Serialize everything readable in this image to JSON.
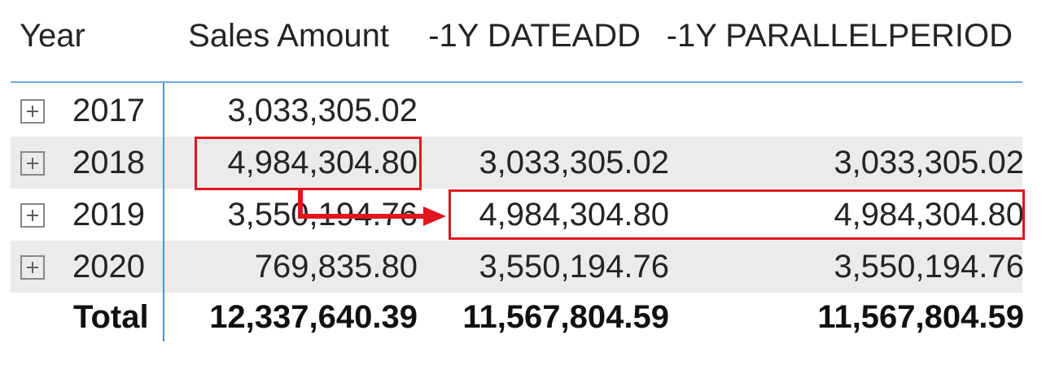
{
  "headers": {
    "year": "Year",
    "sales_amount": "Sales Amount",
    "dateadd": "-1Y DATEADD",
    "parallelperiod": "-1Y PARALLELPERIOD"
  },
  "rows": [
    {
      "year": "2017",
      "sales_amount": "3,033,305.02",
      "dateadd": "",
      "parallelperiod": ""
    },
    {
      "year": "2018",
      "sales_amount": "4,984,304.80",
      "dateadd": "3,033,305.02",
      "parallelperiod": "3,033,305.02"
    },
    {
      "year": "2019",
      "sales_amount": "3,550,194.76",
      "dateadd": "4,984,304.80",
      "parallelperiod": "4,984,304.80"
    },
    {
      "year": "2020",
      "sales_amount": "769,835.80",
      "dateadd": "3,550,194.76",
      "parallelperiod": "3,550,194.76"
    }
  ],
  "total": {
    "label": "Total",
    "sales_amount": "12,337,640.39",
    "dateadd": "11,567,804.59",
    "parallelperiod": "11,567,804.59"
  },
  "colors": {
    "highlight": "#e0161f",
    "accent_line": "#4a90d9",
    "row_shade": "#ebebeb"
  }
}
